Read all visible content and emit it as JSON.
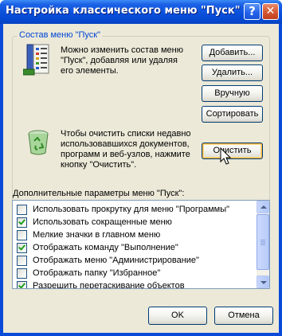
{
  "window": {
    "title": "Настройка классического меню \"Пуск\""
  },
  "titlebar": {
    "help_glyph": "?",
    "close_glyph": "✕"
  },
  "start_menu_group": {
    "label": "Состав меню \"Пуск\"",
    "description_lines": [
      "Можно изменить состав меню",
      "\"Пуск\", добавляя или удаляя",
      "его элементы."
    ],
    "buttons": {
      "add": "Добавить...",
      "remove": "Удалить...",
      "manual": "Вручную",
      "sort": "Сортировать"
    },
    "clear_description_lines": [
      "Чтобы очистить списки недавно",
      "использовавшихся документов,",
      "программ и веб-узлов, нажмите",
      "кнопку \"Очистить\"."
    ],
    "clear_button": "Очистить"
  },
  "advanced": {
    "label": "Дополнительные параметры меню \"Пуск\":",
    "items": [
      {
        "label": "Использовать прокрутку для меню \"Программы\"",
        "checked": false
      },
      {
        "label": "Использовать сокращенные меню",
        "checked": true
      },
      {
        "label": "Мелкие значки в главном меню",
        "checked": false
      },
      {
        "label": "Отображать команду \"Выполнение\"",
        "checked": true
      },
      {
        "label": "Отображать меню \"Администрирование\"",
        "checked": false
      },
      {
        "label": "Отображать папку \"Избранное\"",
        "checked": false
      },
      {
        "label": "Разрешить перетаскивание объектов",
        "checked": true
      }
    ]
  },
  "footer": {
    "ok": "OK",
    "cancel": "Отмена"
  },
  "colors": {
    "titlebar": "#0a50dc",
    "dialog_bg": "#ece9d8",
    "group_label": "#0046d5",
    "check": "#21a121"
  }
}
